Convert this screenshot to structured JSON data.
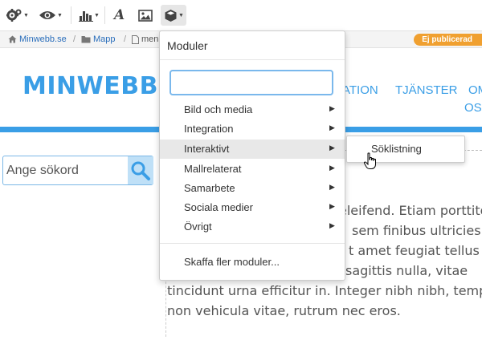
{
  "toolbar": {
    "buttons": [
      {
        "icon": "gears-icon",
        "has_caret": true
      },
      {
        "icon": "eye-icon",
        "has_caret": true
      },
      {
        "icon": "bar-chart-icon",
        "has_caret": true
      },
      {
        "icon": "font-icon",
        "glyph": "A",
        "has_caret": false
      },
      {
        "icon": "image-icon",
        "has_caret": false
      },
      {
        "icon": "cube-icon",
        "has_caret": true,
        "active": true
      }
    ]
  },
  "breadcrumb": {
    "items": [
      "Minwebb.se",
      "Mapp",
      "men"
    ],
    "status_badge": "Ej publicerad"
  },
  "site": {
    "logo": "MINWEBB.SE",
    "nav": [
      "ATION",
      "TJÄNSTER",
      "OM",
      "OSS"
    ]
  },
  "search": {
    "placeholder": "Ange sökord"
  },
  "body_text": [
    "eleifend. Etiam porttitor",
    "sem finibus ultricies.",
    "t amet feugiat tellus",
    "sagittis nulla, vitae",
    "tincidunt urna efficitur in. Integer nibh nibh, tempor",
    "non vehicula vitae, rutrum nec eros."
  ],
  "modules_menu": {
    "title": "Moduler",
    "search_value": "",
    "items": [
      {
        "label": "Bild och media",
        "has_submenu": true
      },
      {
        "label": "Integration",
        "has_submenu": true
      },
      {
        "label": "Interaktivt",
        "has_submenu": true,
        "hovered": true
      },
      {
        "label": "Mallrelaterat",
        "has_submenu": true
      },
      {
        "label": "Samarbete",
        "has_submenu": true
      },
      {
        "label": "Sociala medier",
        "has_submenu": true
      },
      {
        "label": "Övrigt",
        "has_submenu": true
      }
    ],
    "footer_item": "Skaffa fler moduler...",
    "submenu": {
      "items": [
        "Söklistning"
      ]
    }
  },
  "colors": {
    "brand_blue": "#3a9ee6",
    "badge_orange": "#f0a030",
    "link_blue": "#2a6ebb"
  }
}
